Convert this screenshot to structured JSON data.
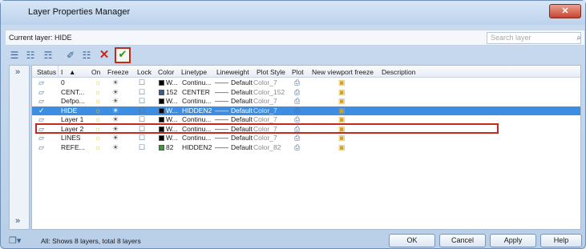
{
  "window": {
    "title": "Layer Properties Manager",
    "close_label": "✕"
  },
  "current_layer": {
    "label": "Current layer: HIDE"
  },
  "search": {
    "placeholder": "Search layer"
  },
  "toolbar": {
    "delete_label": "✕",
    "set_current_label": "✔"
  },
  "left_pane": {
    "expand_top": "»",
    "expand_bottom": "»"
  },
  "columns": [
    "Status",
    "I",
    "▲",
    "On",
    "Freeze",
    "Lock",
    "Color",
    "Linetype",
    "Lineweight",
    "Plot Style",
    "Plot",
    "New viewport freeze",
    "Description"
  ],
  "layers": [
    {
      "name": "0",
      "color_label": "W...",
      "color_hex": "#000000",
      "linetype": "Continu...",
      "lineweight": "Default",
      "plot_style": "Color_7",
      "selected": false
    },
    {
      "name": "CENT...",
      "color_label": "152",
      "color_hex": "#2a5fa0",
      "linetype": "CENTER",
      "lineweight": "Default",
      "plot_style": "Color_152",
      "selected": false
    },
    {
      "name": "Defpo...",
      "color_label": "W...",
      "color_hex": "#000000",
      "linetype": "Continu...",
      "lineweight": "Default",
      "plot_style": "Color_7",
      "selected": false
    },
    {
      "name": "HIDE",
      "color_label": "W...",
      "color_hex": "#000000",
      "linetype": "HIDDEN2",
      "lineweight": "Default",
      "plot_style": "Color_7",
      "selected": true
    },
    {
      "name": "Layer 1",
      "color_label": "W...",
      "color_hex": "#000000",
      "linetype": "Continu...",
      "lineweight": "Default",
      "plot_style": "Color_7",
      "selected": false
    },
    {
      "name": "Layer 2",
      "color_label": "W...",
      "color_hex": "#000000",
      "linetype": "Continu...",
      "lineweight": "Default",
      "plot_style": "Color_7",
      "selected": false
    },
    {
      "name": "LINES",
      "color_label": "W...",
      "color_hex": "#000000",
      "linetype": "Continu...",
      "lineweight": "Default",
      "plot_style": "Color_7",
      "selected": false
    },
    {
      "name": "REFE...",
      "color_label": "82",
      "color_hex": "#3c9a3c",
      "linetype": "HIDDEN2",
      "lineweight": "Default",
      "plot_style": "Color_82",
      "selected": false
    }
  ],
  "status_bar": {
    "text": "All: Shows 8 layers, total 8 layers"
  },
  "buttons": {
    "ok": "OK",
    "cancel": "Cancel",
    "apply": "Apply",
    "help": "Help"
  },
  "icons": {
    "on": "lightbulb-icon",
    "freeze": "sun-icon",
    "lock": "lock-icon",
    "plot": "printer-icon",
    "vp_freeze": "viewport-freeze-icon",
    "status": "layer-status-icon"
  }
}
